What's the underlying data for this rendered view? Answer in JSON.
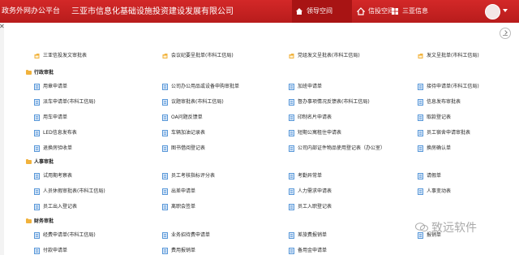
{
  "header": {
    "brand": "政务外网办公平台",
    "company": "三亚市信息化基础设施投资建设发展有限公司",
    "tabs": [
      {
        "label": "领导空间",
        "icon": "home-icon",
        "active": true
      },
      {
        "label": "信投空间",
        "icon": "house-icon",
        "active": false
      },
      {
        "label": "三亚信息",
        "icon": "grid-icon",
        "active": false
      }
    ]
  },
  "colors": {
    "header_bg": "#c62222",
    "active_tab": "#a81414",
    "doc_icon": "#2f7fd0",
    "folder_icon": "#f1b23c"
  },
  "pinned": [
    "三亚信投发文审批表",
    "会议纪要呈批单(市科工信局)",
    "党组发文呈批表(市科工信局)",
    "发文呈批单(市科工信局)"
  ],
  "sections": [
    {
      "title": "行政审批",
      "rows": [
        [
          "用章申请单",
          "公司办公用品或设备申购审批单",
          "加班申请单",
          "接待申请单(市科工信局)"
        ],
        [
          "派车申请单(市科工信局)",
          "议题审批表(市科工信局)",
          "督办事项情况反馈表(市科工信局)",
          "信息发布审批表"
        ],
        [
          "用车申请单",
          "OA问题反馈单",
          "印制名片申请表",
          "取款登记表"
        ],
        [
          "LED信息发布表",
          "车辆加油记录表",
          "短期公寓租住申请表",
          "员工宿舍申请审批表"
        ],
        [
          "退换房验收单",
          "图书借阅登记表",
          "公司内部证件物品使用登记表（办公室）",
          "换房确认单"
        ]
      ]
    },
    {
      "title": "人事审批",
      "rows": [
        [
          "试用期考察表",
          "员工考核指标评分表",
          "考勤异常单",
          "请假单"
        ],
        [
          "人员休假审批表(市科工信局)",
          "出差申请单",
          "人力需求申请表",
          "人事变动表"
        ],
        [
          "员工出入登记表",
          "离职会签单",
          "员工入职登记表",
          ""
        ]
      ]
    },
    {
      "title": "财务审批",
      "rows": [
        [
          "经费申请单(市科工信局)",
          "业务招待费申请单",
          "差旅费报销单",
          "报销单"
        ],
        [
          "付款申请单",
          "费用报销单",
          "备用金申请单",
          ""
        ]
      ]
    }
  ],
  "watermark": "致远软件"
}
